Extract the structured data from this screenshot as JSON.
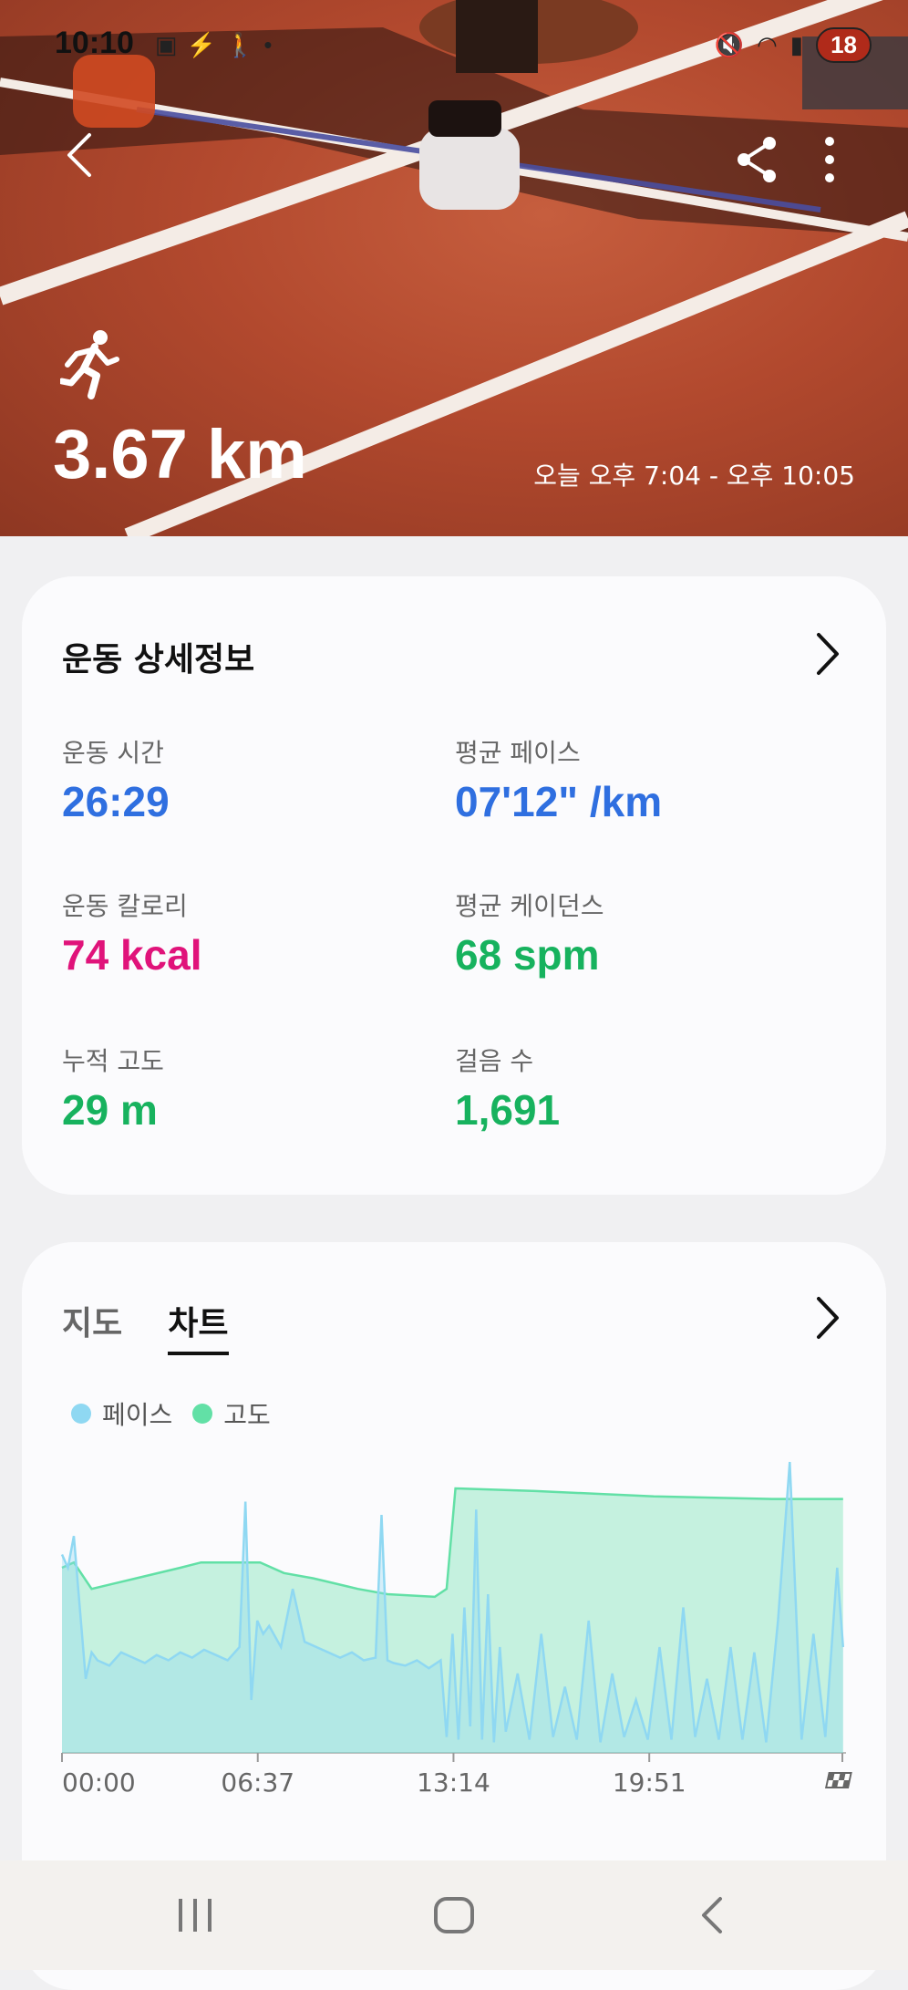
{
  "status_bar": {
    "time": "10:10",
    "battery": "18",
    "left_icons": [
      "screenshot-icon",
      "running-app-icon",
      "walking-icon",
      "dot-icon"
    ],
    "right_icons": [
      "mute-icon",
      "wifi-icon",
      "signal-icon",
      "battery-icon"
    ]
  },
  "hero": {
    "distance": "3.67 km",
    "time_range": "오늘 오후 7:04 - 오후 10:05",
    "activity_icon": "running-icon"
  },
  "details": {
    "title": "운동 상세정보",
    "stats": [
      {
        "label": "운동 시간",
        "value": "26:29",
        "color": "#2f6fe0"
      },
      {
        "label": "평균 페이스",
        "value": "07'12\" /km",
        "color": "#2f6fe0"
      },
      {
        "label": "운동 칼로리",
        "value": "74 kcal",
        "color": "#e0137a"
      },
      {
        "label": "평균 케이던스",
        "value": "68 spm",
        "color": "#17b25e"
      },
      {
        "label": "누적 고도",
        "value": "29 m",
        "color": "#17b25e"
      },
      {
        "label": "걸음 수",
        "value": "1,691",
        "color": "#17b25e"
      }
    ]
  },
  "chart_section": {
    "tabs": [
      "지도",
      "차트"
    ],
    "active_tab": 1,
    "legend": [
      {
        "name": "페이스",
        "color": "#8fd8f2"
      },
      {
        "name": "고도",
        "color": "#62e0a6"
      }
    ]
  },
  "chart_data": {
    "type": "area",
    "x_tick_labels": [
      "00:00",
      "06:37",
      "13:14",
      "19:51"
    ],
    "end_marker": "finish-flag-icon",
    "x_range_minutes": [
      0,
      26.5
    ],
    "series": [
      {
        "name": "고도",
        "color": "#62e0a6",
        "x": [
          0,
          0.4,
          1.0,
          2.5,
          4.0,
          4.7,
          5.8,
          6.7,
          7.5,
          8.5,
          10.0,
          11.0,
          12.6,
          13.0,
          13.3,
          16.0,
          20.0,
          24.0,
          26.4
        ],
        "y": [
          0.7,
          0.72,
          0.62,
          0.66,
          0.7,
          0.72,
          0.72,
          0.72,
          0.68,
          0.66,
          0.62,
          0.6,
          0.59,
          0.62,
          1.0,
          0.99,
          0.97,
          0.96,
          0.96
        ]
      },
      {
        "name": "페이스",
        "color": "#8fd8f2",
        "x": [
          0,
          0.2,
          0.4,
          0.6,
          0.8,
          1.0,
          1.2,
          1.6,
          2.0,
          2.4,
          2.8,
          3.2,
          3.6,
          4.0,
          4.4,
          4.8,
          5.2,
          5.6,
          6.0,
          6.2,
          6.4,
          6.6,
          6.8,
          7.0,
          7.4,
          7.8,
          8.2,
          8.6,
          9.0,
          9.4,
          9.8,
          10.2,
          10.6,
          10.8,
          11.0,
          11.2,
          11.6,
          12.0,
          12.4,
          12.8,
          13.0,
          13.2,
          13.4,
          13.6,
          13.8,
          14.0,
          14.2,
          14.4,
          14.6,
          14.8,
          15.0,
          15.4,
          15.8,
          16.2,
          16.6,
          17.0,
          17.4,
          17.8,
          18.2,
          18.6,
          19.0,
          19.4,
          19.8,
          20.2,
          20.6,
          21.0,
          21.4,
          21.8,
          22.2,
          22.6,
          23.0,
          23.4,
          23.8,
          24.2,
          24.6,
          25.0,
          25.4,
          25.8,
          26.2,
          26.4
        ],
        "y": [
          0.75,
          0.7,
          0.82,
          0.55,
          0.28,
          0.38,
          0.35,
          0.33,
          0.38,
          0.36,
          0.34,
          0.37,
          0.35,
          0.38,
          0.36,
          0.39,
          0.37,
          0.35,
          0.4,
          0.95,
          0.2,
          0.5,
          0.45,
          0.48,
          0.4,
          0.62,
          0.42,
          0.4,
          0.38,
          0.36,
          0.38,
          0.35,
          0.36,
          0.9,
          0.35,
          0.34,
          0.33,
          0.35,
          0.32,
          0.35,
          0.06,
          0.45,
          0.05,
          0.55,
          0.1,
          0.92,
          0.05,
          0.6,
          0.04,
          0.4,
          0.08,
          0.3,
          0.05,
          0.45,
          0.06,
          0.25,
          0.05,
          0.5,
          0.04,
          0.3,
          0.06,
          0.2,
          0.05,
          0.4,
          0.05,
          0.55,
          0.06,
          0.28,
          0.05,
          0.4,
          0.05,
          0.38,
          0.04,
          0.5,
          1.1,
          0.05,
          0.45,
          0.06,
          0.7,
          0.4
        ]
      }
    ]
  },
  "nav_bar": {
    "buttons": [
      "recent-apps-icon",
      "home-icon",
      "back-icon"
    ]
  }
}
